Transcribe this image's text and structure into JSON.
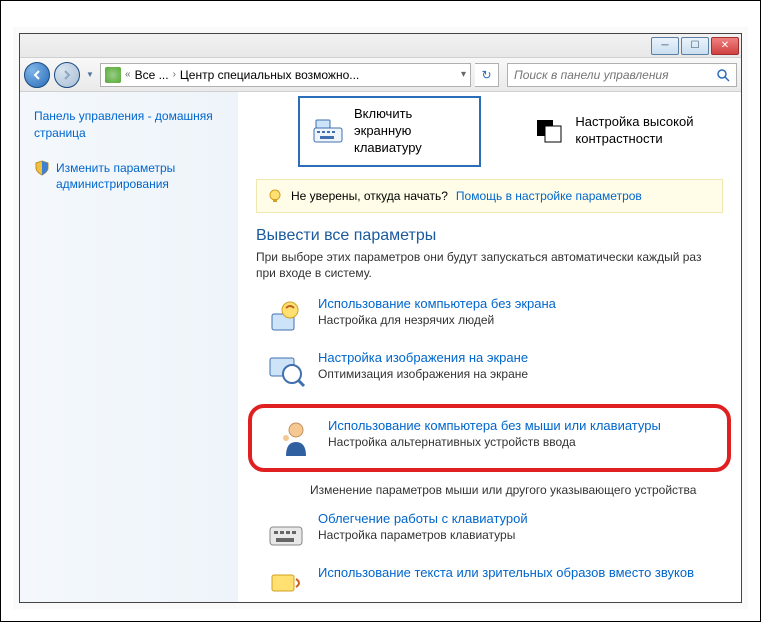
{
  "breadcrumb": {
    "all": "Все ...",
    "current": "Центр специальных возможно..."
  },
  "search": {
    "placeholder": "Поиск в панели управления"
  },
  "sidebar": {
    "home": "Панель управления - домашняя страница",
    "admin": "Изменить параметры администрирования"
  },
  "quick": {
    "osk": "Включить экранную клавиатуру",
    "contrast": "Настройка высокой контрастности"
  },
  "tip": {
    "question": "Не уверены, откуда начать?",
    "link": "Помощь в настройке параметров"
  },
  "section": {
    "title": "Вывести все параметры",
    "desc": "При выборе этих параметров они будут запускаться автоматически каждый раз при входе в систему."
  },
  "options": {
    "nodisplay": {
      "title": "Использование компьютера без экрана",
      "desc": "Настройка для незрячих людей"
    },
    "display": {
      "title": "Настройка изображения на экране",
      "desc": "Оптимизация изображения на экране"
    },
    "nomouse": {
      "title": "Использование компьютера без мыши или клавиатуры",
      "desc": "Настройка альтернативных устройств ввода"
    },
    "mouse": {
      "desc": "Изменение параметров мыши или другого указывающего устройства"
    },
    "keyboard": {
      "title": "Облегчение работы с клавиатурой",
      "desc": "Настройка параметров клавиатуры"
    },
    "sound": {
      "title": "Использование текста или зрительных образов вместо звуков"
    }
  }
}
